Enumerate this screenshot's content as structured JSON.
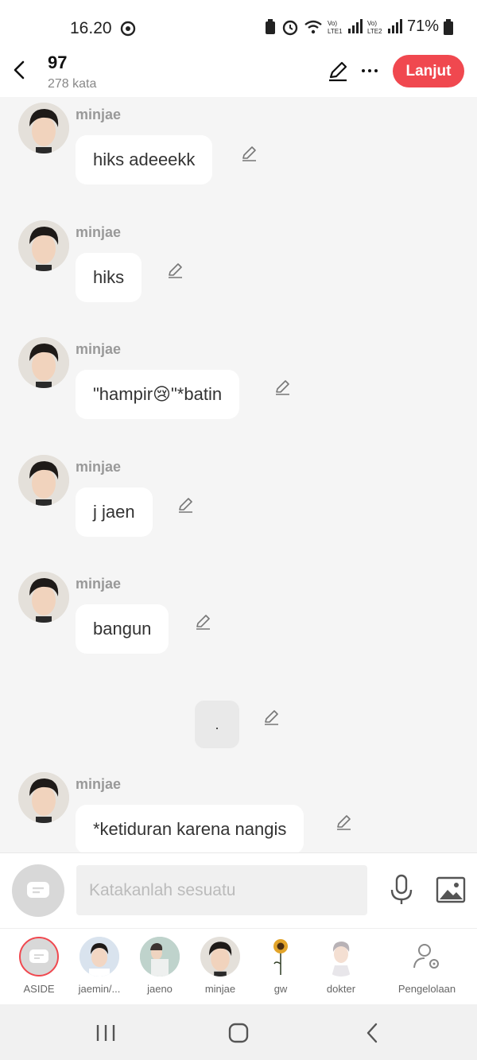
{
  "status_bar": {
    "time": "16.20",
    "battery": "71%"
  },
  "header": {
    "title": "97",
    "subtitle": "278 kata",
    "next_label": "Lanjut"
  },
  "messages": [
    {
      "name": "minjae",
      "text": "hiks adeeekk"
    },
    {
      "name": "minjae",
      "text": "hiks"
    },
    {
      "name": "minjae",
      "text": "\"hampir😢\"*batin"
    },
    {
      "name": "minjae",
      "text": "j jaen"
    },
    {
      "name": "minjae",
      "text": "bangun"
    },
    {
      "name": "",
      "text": "."
    },
    {
      "name": "minjae",
      "text": "*ketiduran karena nangis"
    }
  ],
  "input": {
    "placeholder": "Katakanlah sesuatu"
  },
  "characters": [
    {
      "label": "ASIDE"
    },
    {
      "label": "jaemin/..."
    },
    {
      "label": "jaeno"
    },
    {
      "label": "minjae"
    },
    {
      "label": "gw"
    },
    {
      "label": "dokter"
    },
    {
      "label": "Pengelolaan"
    }
  ],
  "colors": {
    "accent": "#f0484f",
    "background": "#f5f5f5",
    "bubble": "#ffffff"
  },
  "icons": [
    "back-icon",
    "pencil-icon",
    "more-icon",
    "microphone-icon",
    "image-icon",
    "chat-bubble-icon",
    "manage-user-icon"
  ]
}
